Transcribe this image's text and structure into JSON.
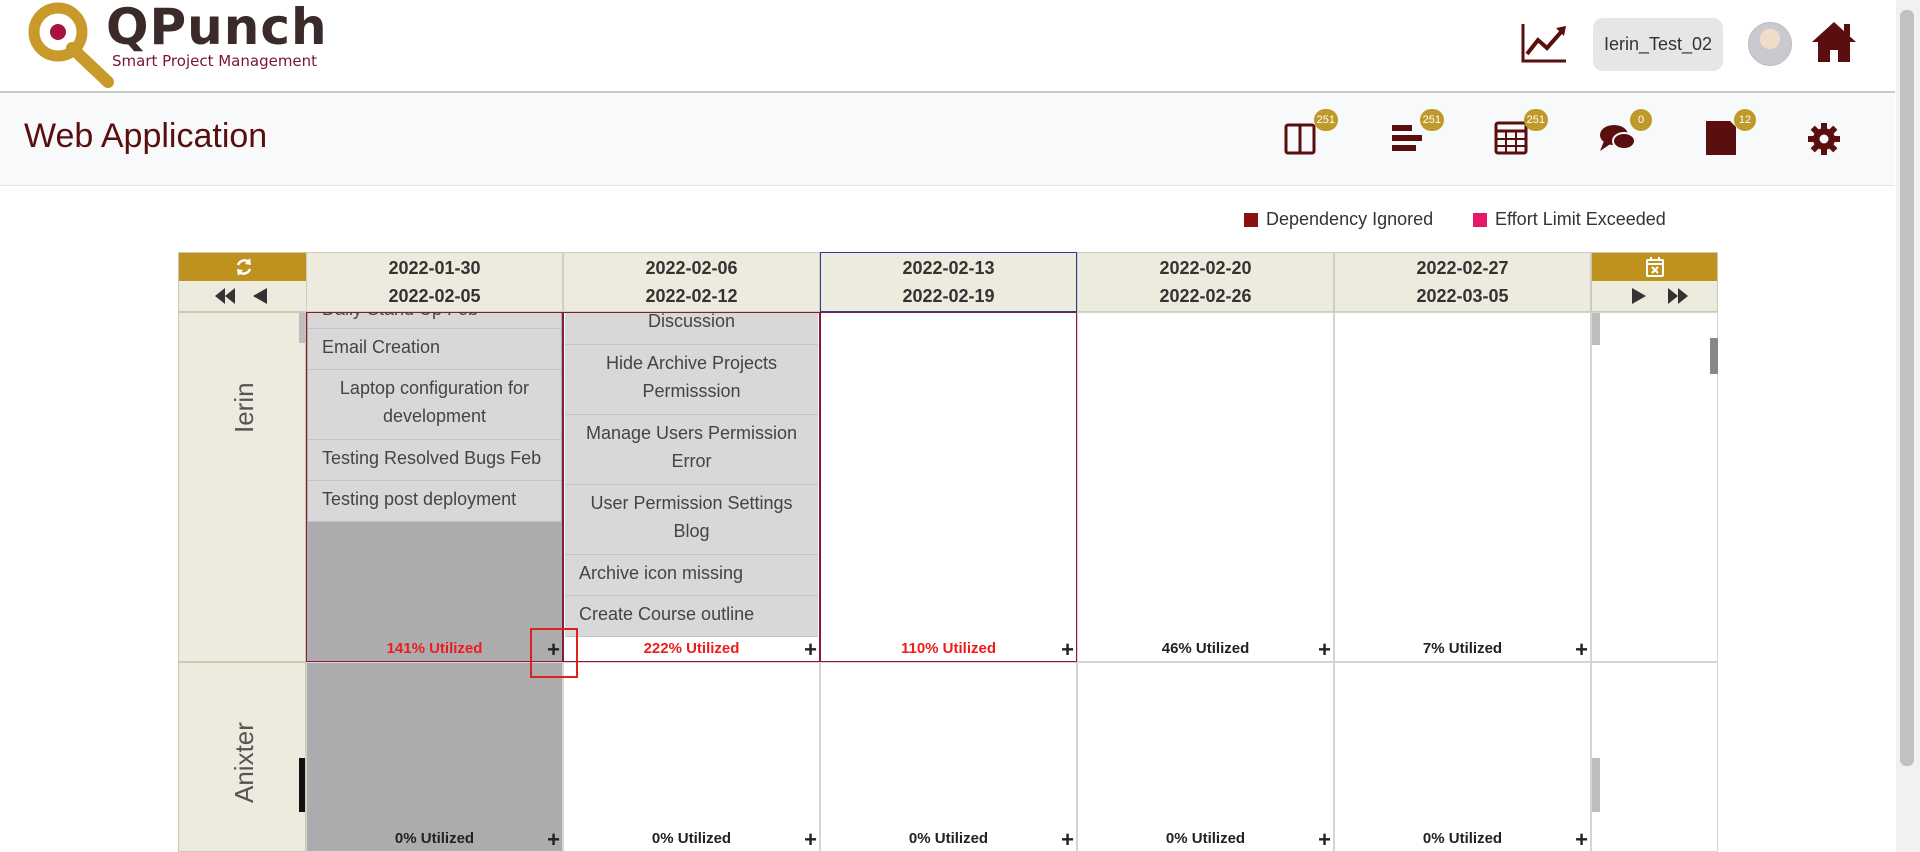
{
  "app": {
    "logo_title": "QPunch",
    "logo_subtitle": "Smart Project Management",
    "user_name": "Ierin_Test_02"
  },
  "page": {
    "title": "Web Application",
    "toolbar": [
      {
        "icon": "board-icon",
        "badge": "251"
      },
      {
        "icon": "gantt-icon",
        "badge": "251"
      },
      {
        "icon": "calendar-grid-icon",
        "badge": "251"
      },
      {
        "icon": "chat-icon",
        "badge": "0"
      },
      {
        "icon": "document-icon",
        "badge": "12"
      },
      {
        "icon": "gear-icon",
        "badge": ""
      }
    ]
  },
  "legend": [
    {
      "label": "Dependency Ignored",
      "color": "#8b1010"
    },
    {
      "label": "Effort Limit Exceeded",
      "color": "#e6196b"
    }
  ],
  "weeks": [
    {
      "start": "2022-01-30",
      "end": "2022-02-05"
    },
    {
      "start": "2022-02-06",
      "end": "2022-02-12"
    },
    {
      "start": "2022-02-13",
      "end": "2022-02-19"
    },
    {
      "start": "2022-02-20",
      "end": "2022-02-26"
    },
    {
      "start": "2022-02-27",
      "end": "2022-03-05"
    }
  ],
  "rows": [
    {
      "name": "Ierin",
      "utilization": [
        "141% Utilized",
        "222% Utilized",
        "110% Utilized",
        "46% Utilized",
        "7% Utilized"
      ],
      "week1_tasks": [
        "Daily Stand Up Feb",
        "Email Creation",
        "Laptop configuration for development",
        "Testing Resolved Bugs Feb",
        "Testing post deployment"
      ],
      "week2_tasks": [
        "Discussion",
        "Hide Archive Projects Permisssion",
        "Manage Users Permission Error",
        "User Permission Settings Blog",
        "Archive icon missing",
        "Create Course outline"
      ]
    },
    {
      "name": "Anixter",
      "utilization": [
        "0% Utilized",
        "0% Utilized",
        "0% Utilized",
        "0% Utilized",
        "0% Utilized"
      ]
    }
  ],
  "plus_label": "+"
}
